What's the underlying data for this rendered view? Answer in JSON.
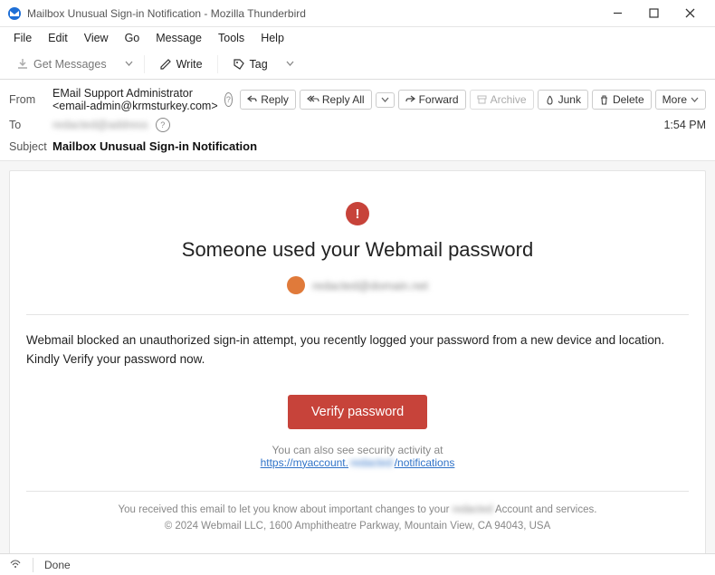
{
  "window": {
    "title": "Mailbox Unusual Sign-in Notification - Mozilla Thunderbird"
  },
  "menu": {
    "file": "File",
    "edit": "Edit",
    "view": "View",
    "go": "Go",
    "message": "Message",
    "tools": "Tools",
    "help": "Help"
  },
  "toolbar": {
    "get_messages": "Get Messages",
    "write": "Write",
    "tag": "Tag"
  },
  "header": {
    "from_label": "From",
    "from_value": "EMail Support Administrator <email-admin@krmsturkey.com>",
    "to_label": "To",
    "to_value_blurred": "redacted@address",
    "time": "1:54 PM",
    "subject_label": "Subject",
    "subject_value": "Mailbox Unusual Sign-in Notification",
    "actions": {
      "reply": "Reply",
      "reply_all": "Reply All",
      "forward": "Forward",
      "archive": "Archive",
      "junk": "Junk",
      "delete": "Delete",
      "more": "More"
    }
  },
  "body": {
    "headline": "Someone used your Webmail password",
    "account_blurred": "redacted@domain.net",
    "paragraph": "Webmail blocked an unauthorized sign-in attempt, you recently logged your password from a new device and location. Kindly Verify your password now.",
    "verify_button": "Verify password",
    "sub_text": "You can also see security activity at",
    "link_prefix": "https://myaccount.",
    "link_mid_blurred": "redacted",
    "link_suffix": "/notifications",
    "footer_line1_pre": "You received this email to let you know about important changes to your ",
    "footer_line1_blur": "redacted",
    "footer_line1_post": " Account and services.",
    "footer_line2": "© 2024 Webmail LLC,  1600 Amphitheatre Parkway, Mountain View, CA 94043, USA"
  },
  "statusbar": {
    "done": "Done"
  }
}
